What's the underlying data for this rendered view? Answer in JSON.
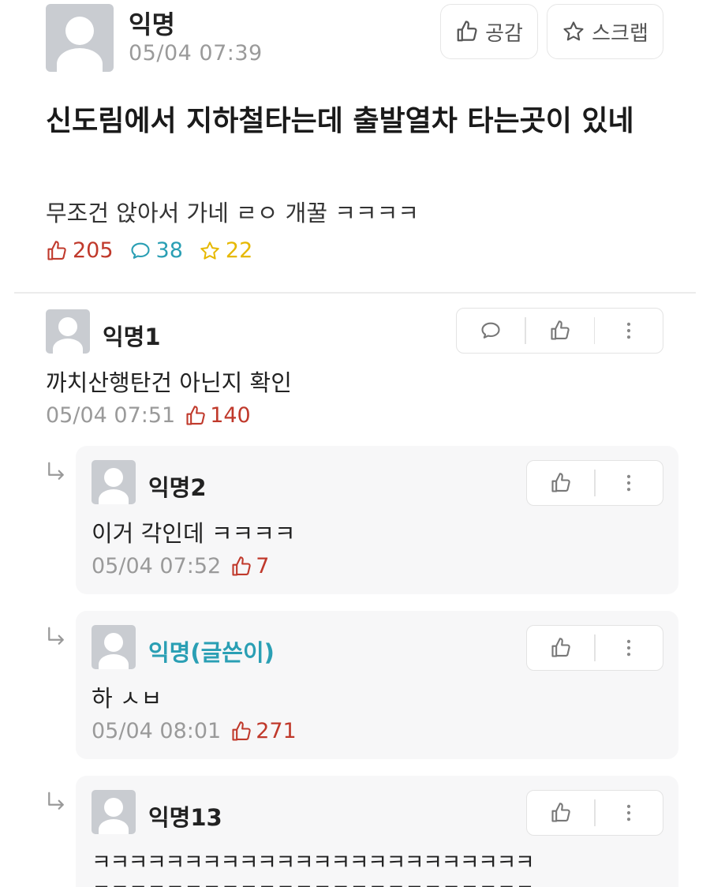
{
  "post": {
    "author": "익명",
    "date": "05/04 07:39",
    "title": "신도림에서 지하철타는데 출발열차 타는곳이 있네",
    "body": "무조건 앉아서 가네 ㄹㅇ 개꿀 ㅋㅋㅋㅋ",
    "likes": "205",
    "comments": "38",
    "scraps": "22",
    "like_button_label": "공감",
    "scrap_button_label": "스크랩"
  },
  "comments": [
    {
      "author": "익명1",
      "text": "까치산행탄건 아닌지 확인",
      "date": "05/04 07:51",
      "likes": "140"
    }
  ],
  "replies": [
    {
      "author": "익명2",
      "text": "이거 각인데 ㅋㅋㅋㅋ",
      "date": "05/04 07:52",
      "likes": "7"
    },
    {
      "author": "익명(글쓴이)",
      "text": "하 ㅅㅂ",
      "date": "05/04 08:01",
      "likes": "271",
      "is_op": true
    },
    {
      "author": "익명13",
      "text": "ㅋㅋㅋㅋㅋㅋㅋㅋㅋㅋㅋㅋㅋㅋㅋㅋㅋㅋㅋㅋㅋㅋㅋㅋ",
      "text2": "ㅋㅋㅋㅋㅋㅋㅋㅋㅋㅋㅋㅋㅋㅋㅋㅋㅋㅋㅋㅋㅋㅋㅋㅋ"
    }
  ],
  "colors": {
    "like": "#c0392b",
    "comment": "#2a9fb4",
    "scrap": "#e6b800",
    "op_name": "#2a9fb4"
  },
  "icons": [
    "thumbs-up-icon",
    "star-icon",
    "speech-bubble-icon",
    "more-vertical-icon",
    "reply-arrow-icon"
  ]
}
